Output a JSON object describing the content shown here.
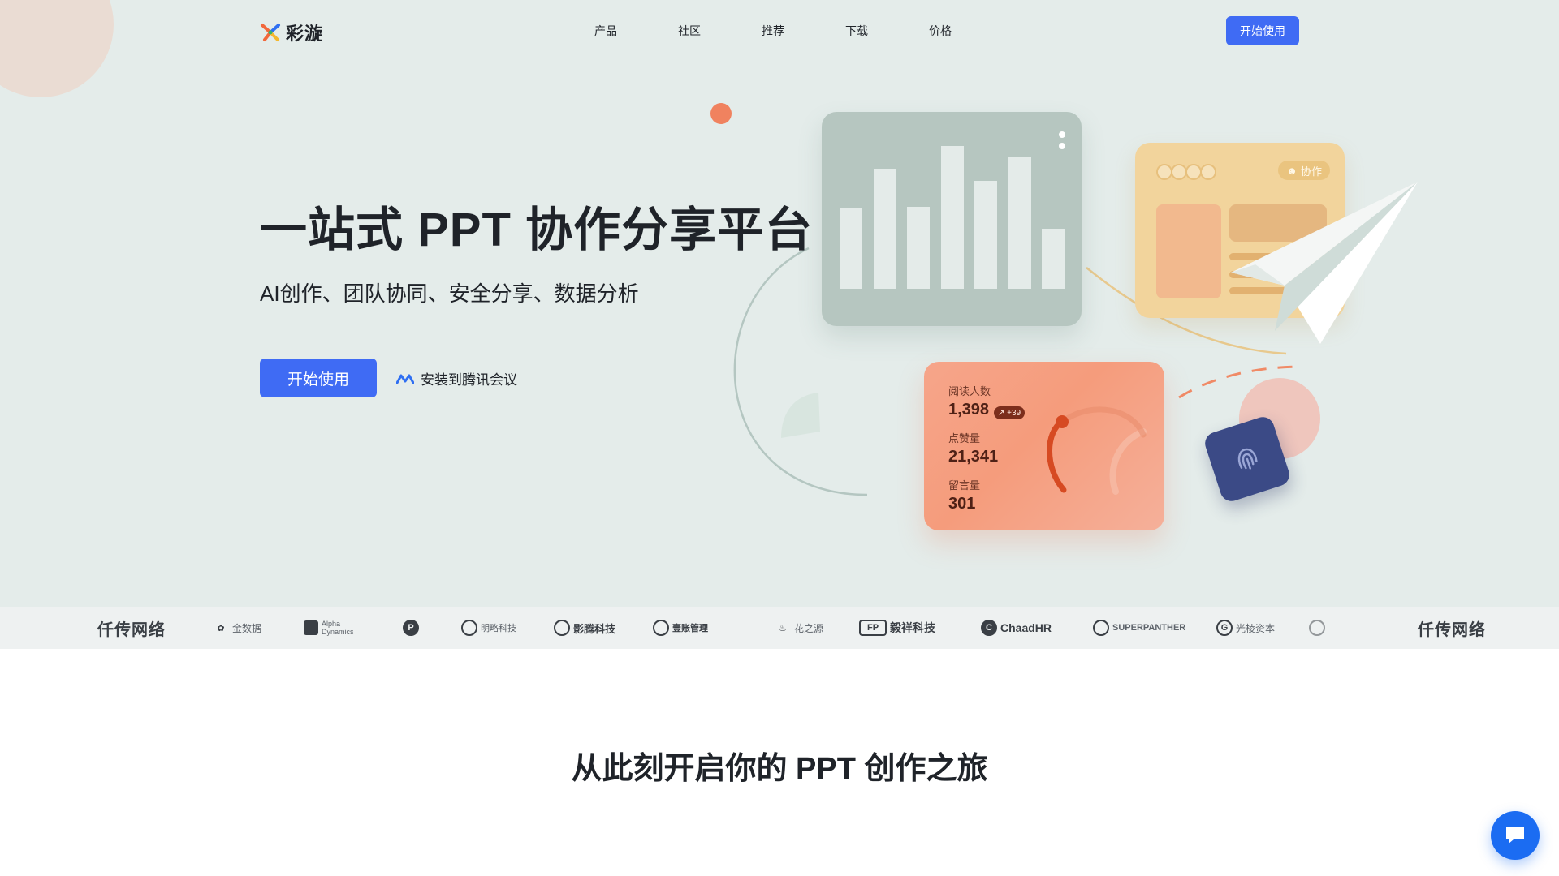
{
  "brand": {
    "name": "彩漩",
    "logo_icon": "caixuan-logo-icon"
  },
  "nav": {
    "links": [
      "产品",
      "社区",
      "推荐",
      "下载",
      "价格"
    ],
    "cta_label": "开始使用"
  },
  "hero": {
    "title": "一站式 PPT 协作分享平台",
    "subtitle": "AI创作、团队协同、安全分享、数据分析",
    "cta_label": "开始使用",
    "install_label": "安装到腾讯会议",
    "install_icon": "tencent-meeting-icon"
  },
  "illustration": {
    "collab_tag": "协作",
    "stats": [
      {
        "label": "阅读人数",
        "value": "1,398",
        "badge": "↗ +39"
      },
      {
        "label": "点赞量",
        "value": "21,341"
      },
      {
        "label": "留言量",
        "value": "301"
      }
    ],
    "bar_levels": [
      0.55,
      0.82,
      0.56,
      0.98,
      0.74,
      0.9,
      0.41
    ]
  },
  "partners": [
    {
      "name": "仟传网络",
      "style": "serif"
    },
    {
      "name": "金数据",
      "style": "light"
    },
    {
      "name": "Alpha Dynamics",
      "style": "light"
    },
    {
      "name": "P",
      "style": "icon"
    },
    {
      "name": "明略科技",
      "style": "light"
    },
    {
      "name": "影腾科技",
      "style": "bold"
    },
    {
      "name": "壹账管理",
      "style": "bold"
    },
    {
      "name": "花之源",
      "style": "light"
    },
    {
      "name": "毅祥科技",
      "style": "bold"
    },
    {
      "name": "ChaadHR",
      "style": "bold"
    },
    {
      "name": "SUPERPANTHER",
      "style": "light"
    },
    {
      "name": "光棱资本",
      "style": "light"
    },
    {
      "name": "仟传网络",
      "style": "serif"
    }
  ],
  "section": {
    "title": "从此刻开启你的 PPT 创作之旅"
  },
  "colors": {
    "primary": "#3f6bf4",
    "hero_bg": "#e4ecea",
    "chat": "#1b6cf2"
  }
}
